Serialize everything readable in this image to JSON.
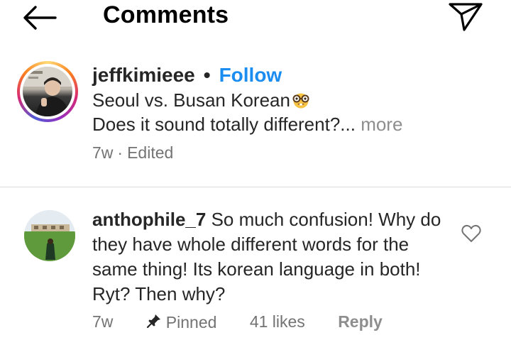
{
  "header": {
    "title": "Comments",
    "back_icon": "back-arrow-icon",
    "share_icon": "send-paper-plane-icon"
  },
  "caption": {
    "username": "jeffkimieee",
    "separator": "•",
    "follow_label": "Follow",
    "line1": "Seoul vs. Busan Korean",
    "emoji": "nerd-face-emoji",
    "line2": "Does it sound totally different?...",
    "more_label": " more",
    "time": "7w",
    "meta_sep": "·",
    "edited": "Edited"
  },
  "comment": {
    "username": "anthophile_7",
    "text": " So much confusion! Why do they have whole different words for the same thing! Its korean language in both! Ryt? Then why?",
    "time": "7w",
    "pinned_label": "Pinned",
    "likes_label": "41 likes",
    "reply_label": "Reply",
    "like_icon": "heart-outline-icon"
  },
  "colors": {
    "follow_blue": "#1b8cf0",
    "meta_gray": "#737373",
    "text": "#262626",
    "divider": "#dbdbdb"
  }
}
